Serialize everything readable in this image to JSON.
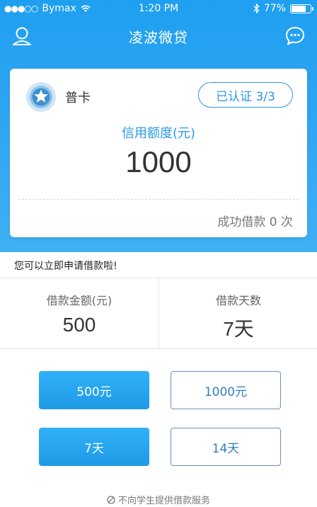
{
  "status_bar": {
    "carrier": "Bymax",
    "signal_dots": "●●●○○",
    "time": "1:20 PM",
    "battery": "77%",
    "battery_level": 0.77
  },
  "nav": {
    "title": "凌波微贷",
    "left_icon": "user-icon",
    "right_icon": "chat-bubble-icon"
  },
  "card": {
    "tier_icon": "star-badge-icon",
    "tier": "普卡",
    "verify_button": "已认证 3/3",
    "credit_label": "信用额度(元)",
    "credit_value": "1000",
    "success_count": "成功借款 0 次"
  },
  "notice": "您可以立即申请借款啦!",
  "loan_info": {
    "amount_label": "借款金额(元)",
    "amount_value": "500",
    "days_label": "借款天数",
    "days_value": "7天"
  },
  "amount_options": [
    {
      "label": "500元",
      "selected": true
    },
    {
      "label": "1000元",
      "selected": false
    }
  ],
  "day_options": [
    {
      "label": "7天",
      "selected": true
    },
    {
      "label": "14天",
      "selected": false
    }
  ],
  "footer": {
    "icon": "ban-icon",
    "text": "不向学生提供借款服务"
  },
  "colors": {
    "primary": "#1f9ff0",
    "accent_text": "#2a98e6"
  }
}
